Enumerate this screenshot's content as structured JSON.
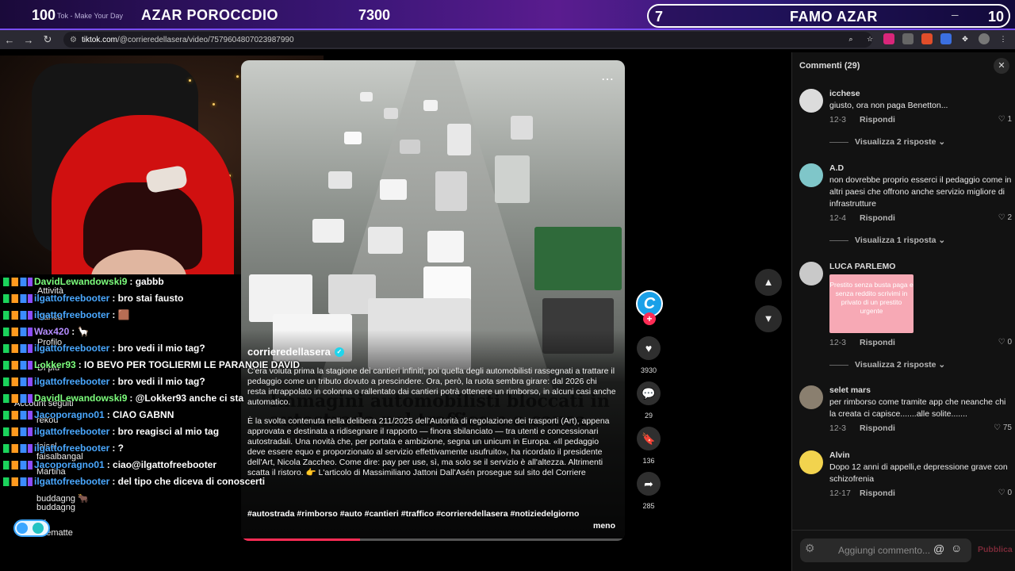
{
  "overlay": {
    "left_number": "100",
    "tab_ghost": "Tok - Make Your Day",
    "title": "AZAR POROCCDIO",
    "center_number": "7300",
    "pill_number": "7",
    "pill_title": "FAMO AZAR",
    "right_number": "10"
  },
  "browser": {
    "url_host": "tiktok.com",
    "url_path": "/@corrieredellasera/video/7579604807023987990"
  },
  "video": {
    "author": "corrieredellasera",
    "headline_ghost": "Immagini automobilisti bloccati in autostrada nel traffico o a causa",
    "caption_p1": "C'era voluta prima la stagione dei cantieri infiniti, poi quella degli automobilisti rassegnati a trattare il pedaggio come un tributo dovuto a prescindere. Ora, però, la ruota sembra girare: dal 2026 chi resta intrappolato in colonna o rallentato dai cantieri potrà ottenere un rimborso, in alcuni casi anche automatico.",
    "caption_p2": "È la svolta contenuta nella delibera 211/2025 dell'Autorità di regolazione dei trasporti (Art), appena approvata e destinata a ridisegnare il rapporto — finora sbilanciato — tra utenti e concessionari autostradali. Una novità che, per portata e ambizione, segna un unicum in Europa. «Il pedaggio deve essere equo e proporzionato al servizio effettivamente usufruito», ha ricordato il presidente dell'Art, Nicola Zaccheo. Come dire: pay per use, sì, ma solo se il servizio è all'altezza. Altrimenti scatta il ristoro. 👉 L'articolo di Massimiliano Jattoni Dall'Asén prosegue sul sito del Corriere",
    "hashtags": "#autostrada #rimborso #auto #cantieri #traffico #corrieredellasera #notiziedelgiorno",
    "less_label": "meno",
    "progress": 0.31
  },
  "actions": {
    "likes": "3930",
    "comments": "29",
    "saves": "136",
    "shares": "285"
  },
  "comments_panel": {
    "header": "Commenti (29)",
    "reply_label": "Rispondi",
    "input_placeholder": "Aggiungi commento...",
    "post_label": "Pubblica",
    "items": [
      {
        "user": "icchese",
        "text": "giusto, ora non paga Benetton...",
        "date": "12-3",
        "likes": "1",
        "replies": "Visualizza 2 risposte ⌄"
      },
      {
        "user": "A.D",
        "text": "non dovrebbe proprio esserci il pedaggio come in altri paesi che offrono anche servizio migliore di infrastrutture",
        "date": "12-4",
        "likes": "2",
        "replies": "Visualizza 1 risposta ⌄"
      },
      {
        "user": "LUCA PARLEMO",
        "image_text": "Prestito senza busta paga e senza reddito scrivimi in privato di un prestito urgente",
        "date": "12-3",
        "likes": "0",
        "replies": "Visualizza 2 risposte ⌄"
      },
      {
        "user": "selet mars",
        "text": "per rimborso come tramite app che neanche chi la creata ci capisce.......alle solite.......",
        "date": "12-3",
        "likes": "75"
      },
      {
        "user": "Alvin",
        "text": "Dopo 12 anni di appelli,e depressione grave con schizofrenia",
        "date": "12-17",
        "likes": "0"
      }
    ]
  },
  "chat": {
    "lines": [
      {
        "user": "DavidLewandowski9",
        "text": ": gabbb",
        "color": "#7dff7d"
      },
      {
        "user": "ilgattofreebooter",
        "text": ": bro stai fausto",
        "color": "#4aa8ff"
      },
      {
        "user": "ilgattofreebooter",
        "text": ": 🟫",
        "color": "#4aa8ff"
      },
      {
        "user": "Wax420",
        "text": ": 🦙",
        "color": "#b48cff"
      },
      {
        "user": "ilgattofreebooter",
        "text": ": bro vedi il mio tag?",
        "color": "#4aa8ff"
      },
      {
        "user": "Lokker93",
        "text": ": IO BEVO PER TOGLIERMI LE PARANOIE DAVID",
        "color": "#7dff7d"
      },
      {
        "user": "ilgattofreebooter",
        "text": ": bro vedi il mio tag?",
        "color": "#4aa8ff"
      },
      {
        "user": "DavidLewandowski9",
        "text": ": @Lokker93 anche ci sta",
        "color": "#7dff7d"
      },
      {
        "user": "Jacoporagno01",
        "text": ": CIAO GABNN",
        "color": "#4aa8ff"
      },
      {
        "user": "ilgattofreebooter",
        "text": ": bro reagisci al mio tag",
        "color": "#4aa8ff"
      },
      {
        "user": "ilgattofreebooter",
        "text": ": ?",
        "color": "#4aa8ff"
      },
      {
        "user": "Jacoporagno01",
        "text": ": ciao@ilgattofreebooter",
        "color": "#4aa8ff"
      },
      {
        "user": "ilgattofreebooter",
        "text": ": del tipo che diceva di conoscerti",
        "color": "#4aa8ff"
      }
    ],
    "ghost_sidebar": [
      "Attività",
      "Carica",
      "Profilo",
      "Di più",
      "Account seguiti",
      "rekou",
      "faisal",
      "faisalbangal",
      "Martina",
      "buddagng 🐂",
      "buddagng",
      "ari",
      "ridematte"
    ]
  }
}
